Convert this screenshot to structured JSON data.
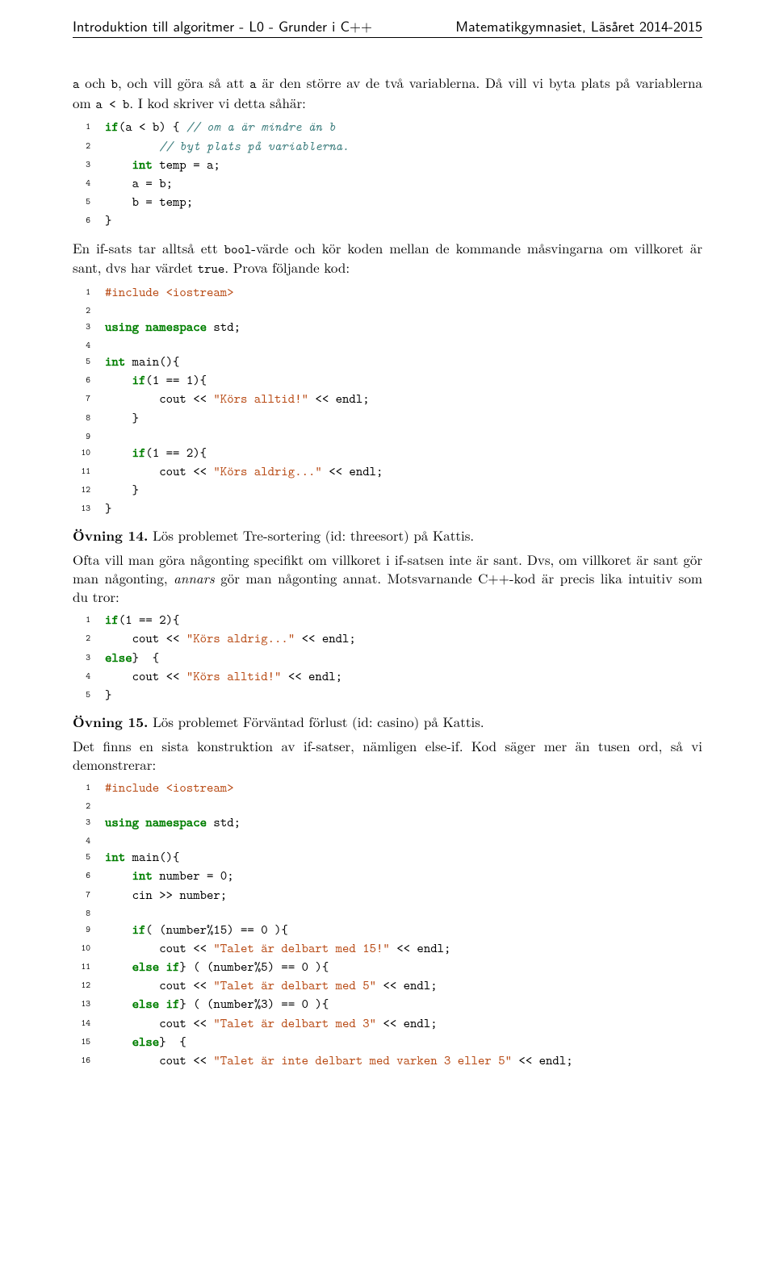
{
  "header": {
    "left": "Introduktion till algoritmer - L0 - Grunder i C++",
    "right": "Matematikgymnasiet, Läsåret 2014-2015"
  },
  "p1": {
    "t1": " och ",
    "t2": ", och vill göra så att ",
    "t3": " är den större av de två variablerna. Då vill vi byta plats på variablerna om ",
    "t4": ". I kod skriver vi detta såhär:",
    "a": "a",
    "b": "b",
    "c": "a",
    "d": "a < b"
  },
  "code1": [
    {
      "ln": "1",
      "kw1": "if",
      "t1": "(a < b) { ",
      "cm": "// om a är mindre än b"
    },
    {
      "ln": "2",
      "pad": "        ",
      "cm": "// byt plats på variablerna."
    },
    {
      "ln": "3",
      "pad": "    ",
      "kw": "int",
      "t": " temp = a;"
    },
    {
      "ln": "4",
      "pad": "    ",
      "t": "a = b;"
    },
    {
      "ln": "5",
      "pad": "    ",
      "t": "b = temp;"
    },
    {
      "ln": "6",
      "t": "}"
    }
  ],
  "p2": {
    "t1": "En if-sats tar alltså ett ",
    "t2": "-värde och kör koden mellan de kommande måsvingarna om villkoret är sant, dvs har värdet ",
    "t3": ". Prova följande kod:",
    "bool": "bool",
    "true": "true"
  },
  "code2": [
    {
      "ln": "1",
      "pp": "#include <iostream>"
    },
    {
      "ln": "2",
      "t": ""
    },
    {
      "ln": "3",
      "kw": "using namespace",
      "t": " std;"
    },
    {
      "ln": "4",
      "t": ""
    },
    {
      "ln": "5",
      "kw": "int",
      "t": " main(){"
    },
    {
      "ln": "6",
      "pad": "    ",
      "kw": "if",
      "t": "(1 == 1){"
    },
    {
      "ln": "7",
      "pad": "        ",
      "t1": "cout << ",
      "str": "\"Körs alltid!\"",
      "t2": " << endl;"
    },
    {
      "ln": "8",
      "pad": "    ",
      "t": "}"
    },
    {
      "ln": "9",
      "t": ""
    },
    {
      "ln": "10",
      "pad": "    ",
      "kw": "if",
      "t": "(1 == 2){"
    },
    {
      "ln": "11",
      "pad": "        ",
      "t1": "cout << ",
      "str": "\"Körs aldrig...\"",
      "t2": " << endl;"
    },
    {
      "ln": "12",
      "pad": "    ",
      "t": "}"
    },
    {
      "ln": "13",
      "t": "}"
    }
  ],
  "ex14": {
    "label": "Övning 14.",
    "text": " Lös problemet Tre-sortering (id: threesort) på Kattis."
  },
  "p3": {
    "t1": "Ofta vill man göra någonting specifikt om villkoret i if-satsen inte är sant. Dvs, om villkoret är sant gör man någonting, ",
    "em": "annars",
    "t2": " gör man någonting annat. Motsvarnande C++-kod är precis lika intuitiv som du tror:"
  },
  "code3": [
    {
      "ln": "1",
      "kw": "if",
      "t": "(1 == 2){"
    },
    {
      "ln": "2",
      "pad": "    ",
      "t1": "cout << ",
      "str": "\"Körs aldrig...\"",
      "t2": " << endl;"
    },
    {
      "ln": "3",
      "t1": "} ",
      "kw": "else",
      "t2": " {"
    },
    {
      "ln": "4",
      "pad": "    ",
      "t1": "cout << ",
      "str": "\"Körs alltid!\"",
      "t2": " << endl;"
    },
    {
      "ln": "5",
      "t": "}"
    }
  ],
  "ex15": {
    "label": "Övning 15.",
    "text": " Lös problemet Förväntad förlust (id: casino) på Kattis."
  },
  "p4": "Det finns en sista konstruktion av if-satser, nämligen else-if. Kod säger mer än tusen ord, så vi demonstrerar:",
  "code4": [
    {
      "ln": "1",
      "pp": "#include <iostream>"
    },
    {
      "ln": "2",
      "t": ""
    },
    {
      "ln": "3",
      "kw": "using namespace",
      "t": " std;"
    },
    {
      "ln": "4",
      "t": ""
    },
    {
      "ln": "5",
      "kw": "int",
      "t": " main(){"
    },
    {
      "ln": "6",
      "pad": "    ",
      "kw": "int",
      "t": " number = 0;"
    },
    {
      "ln": "7",
      "pad": "    ",
      "t": "cin >> number;"
    },
    {
      "ln": "8",
      "t": ""
    },
    {
      "ln": "9",
      "pad": "    ",
      "kw": "if",
      "t": "( (number%15) == 0 ){"
    },
    {
      "ln": "10",
      "pad": "        ",
      "t1": "cout << ",
      "str": "\"Talet är delbart med 15!\"",
      "t2": " << endl;"
    },
    {
      "ln": "11",
      "pad": "    ",
      "t1": "} ",
      "kw": "else if",
      "t2": "( (number%5) == 0 ){"
    },
    {
      "ln": "12",
      "pad": "        ",
      "t1": "cout << ",
      "str": "\"Talet är delbart med 5\"",
      "t2": " << endl;"
    },
    {
      "ln": "13",
      "pad": "    ",
      "t1": "} ",
      "kw": "else if",
      "t2": "( (number%3) == 0 ){"
    },
    {
      "ln": "14",
      "pad": "        ",
      "t1": "cout << ",
      "str": "\"Talet är delbart med 3\"",
      "t2": " << endl;"
    },
    {
      "ln": "15",
      "pad": "    ",
      "t1": "} ",
      "kw": "else",
      "t2": " {"
    },
    {
      "ln": "16",
      "pad": "        ",
      "t1": "cout << ",
      "str": "\"Talet är inte delbart med varken 3 eller 5\"",
      "t2": " << endl;"
    }
  ]
}
